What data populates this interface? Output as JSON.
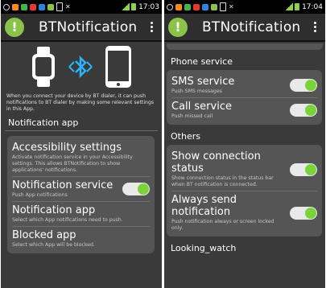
{
  "left": {
    "status": {
      "time": "17:03"
    },
    "app_title": "BTNotification",
    "intro_text": "When you connect your device by BT dialer, it can push notifications to BT dialer by making some relevant settings in this App.",
    "section_title": "Notification app",
    "items": [
      {
        "title": "Accessibility settings",
        "sub": "Activate notification service in your Accessibility settings. This allows BTNotification to show applications' notifications."
      },
      {
        "title": "Notification service",
        "sub": "Push App notifications",
        "toggle": true
      },
      {
        "title": "Notification app",
        "sub": "Select which App notifications need to push."
      },
      {
        "title": "Blocked app",
        "sub": "Select which App will be blocked."
      }
    ]
  },
  "right": {
    "status": {
      "time": "17:04"
    },
    "app_title": "BTNotification",
    "phone_section": "Phone service",
    "phone_items": [
      {
        "title": "SMS service",
        "sub": "Push SMS messages",
        "toggle": true
      },
      {
        "title": "Call service",
        "sub": "Push missed call",
        "toggle": true
      }
    ],
    "others_section": "Others",
    "other_items": [
      {
        "title": "Show connection status",
        "sub": "Show connection status in the status bar when BT notification is connected.",
        "toggle": true
      },
      {
        "title": "Always send notification",
        "sub": "Push notification always or screen locked only.",
        "toggle": true
      }
    ],
    "looking_watch": "Looking_watch"
  },
  "icons": [
    "search-icon",
    "app-icon",
    "overflow-menu-icon",
    "smartwatch-icon",
    "bluetooth-icon",
    "smartphone-icon",
    "signal-icon",
    "battery-icon"
  ],
  "colors": {
    "toggle_on": "#7bd33b",
    "app_icon": "#8bc34a",
    "background": "#3a3a3a",
    "card": "#555555"
  }
}
